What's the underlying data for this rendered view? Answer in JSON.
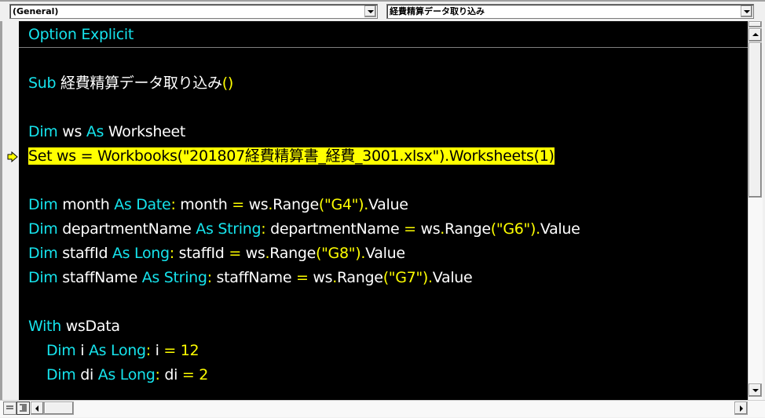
{
  "toolbar": {
    "object_combo": {
      "value": "(General)"
    },
    "procedure_combo": {
      "value": "経費精算データ取り込み"
    }
  },
  "colors": {
    "keyword": "#16e3ec",
    "identifier": "#ffffff",
    "operator": "#ffff00",
    "execution_highlight": "#ffff00",
    "editor_background": "#000000"
  },
  "code": {
    "lines": [
      {
        "tokens": [
          [
            "kw",
            "Option Explicit"
          ]
        ]
      },
      {
        "tokens": []
      },
      {
        "tokens": [
          [
            "kw",
            "Sub"
          ],
          [
            "id",
            " 経費精算データ取り込み"
          ],
          [
            "op",
            "()"
          ]
        ]
      },
      {
        "tokens": []
      },
      {
        "tokens": [
          [
            "kw",
            "Dim"
          ],
          [
            "id",
            " ws "
          ],
          [
            "kw",
            "As"
          ],
          [
            "id",
            " Worksheet"
          ]
        ]
      },
      {
        "tokens": [
          [
            "id",
            "Set ws = Workbooks(\"201807経費精算書_経費_3001.xlsx\").Worksheets(1)"
          ]
        ],
        "highlighted": true
      },
      {
        "tokens": []
      },
      {
        "tokens": [
          [
            "kw",
            "Dim"
          ],
          [
            "id",
            " month "
          ],
          [
            "kw",
            "As Date"
          ],
          [
            "op",
            ":"
          ],
          [
            "id",
            " month "
          ],
          [
            "op",
            "="
          ],
          [
            "id",
            " ws"
          ],
          [
            "op",
            "."
          ],
          [
            "id",
            "Range"
          ],
          [
            "op",
            "(\"G4\")."
          ],
          [
            "id",
            "Value"
          ]
        ]
      },
      {
        "tokens": [
          [
            "kw",
            "Dim"
          ],
          [
            "id",
            " departmentName "
          ],
          [
            "kw",
            "As String"
          ],
          [
            "op",
            ":"
          ],
          [
            "id",
            " departmentName "
          ],
          [
            "op",
            "="
          ],
          [
            "id",
            " ws"
          ],
          [
            "op",
            "."
          ],
          [
            "id",
            "Range"
          ],
          [
            "op",
            "(\"G6\")."
          ],
          [
            "id",
            "Value"
          ]
        ]
      },
      {
        "tokens": [
          [
            "kw",
            "Dim"
          ],
          [
            "id",
            " staffId "
          ],
          [
            "kw",
            "As Long"
          ],
          [
            "op",
            ":"
          ],
          [
            "id",
            " staffId "
          ],
          [
            "op",
            "="
          ],
          [
            "id",
            " ws"
          ],
          [
            "op",
            "."
          ],
          [
            "id",
            "Range"
          ],
          [
            "op",
            "(\"G8\")."
          ],
          [
            "id",
            "Value"
          ]
        ]
      },
      {
        "tokens": [
          [
            "kw",
            "Dim"
          ],
          [
            "id",
            " staffName "
          ],
          [
            "kw",
            "As String"
          ],
          [
            "op",
            ":"
          ],
          [
            "id",
            " staffName "
          ],
          [
            "op",
            "="
          ],
          [
            "id",
            " ws"
          ],
          [
            "op",
            "."
          ],
          [
            "id",
            "Range"
          ],
          [
            "op",
            "(\"G7\")."
          ],
          [
            "id",
            "Value"
          ]
        ]
      },
      {
        "tokens": []
      },
      {
        "tokens": [
          [
            "kw",
            "With"
          ],
          [
            "id",
            " wsData"
          ]
        ]
      },
      {
        "tokens": [
          [
            "id",
            "    "
          ],
          [
            "kw",
            "Dim"
          ],
          [
            "id",
            " i "
          ],
          [
            "kw",
            "As Long"
          ],
          [
            "op",
            ":"
          ],
          [
            "id",
            " i "
          ],
          [
            "op",
            "= 12"
          ]
        ]
      },
      {
        "tokens": [
          [
            "id",
            "    "
          ],
          [
            "kw",
            "Dim"
          ],
          [
            "id",
            " di "
          ],
          [
            "kw",
            "As Long"
          ],
          [
            "op",
            ":"
          ],
          [
            "id",
            " di "
          ],
          [
            "op",
            "= 2"
          ]
        ]
      }
    ]
  },
  "icons": {
    "execution_pointer": "yellow-arrow",
    "procedure_view": "procedure-view-icon",
    "full_module_view": "full-module-view-icon"
  }
}
